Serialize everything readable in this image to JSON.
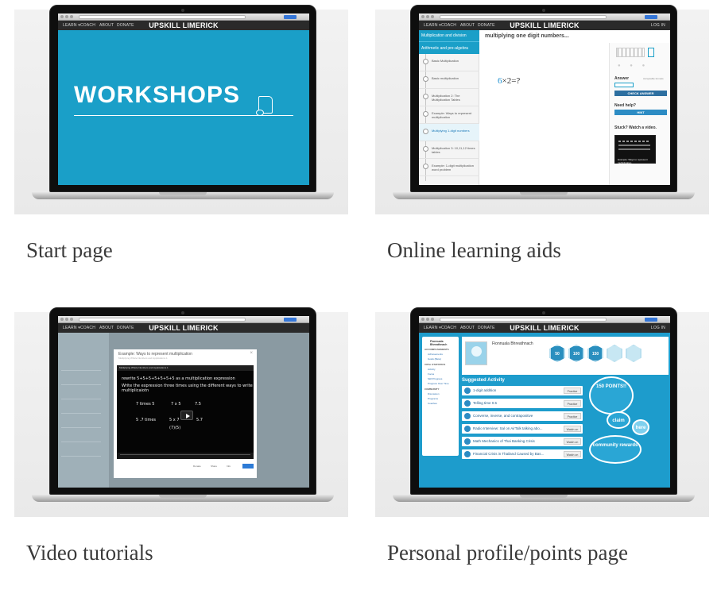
{
  "panels": [
    {
      "caption": "Start page",
      "site": {
        "brand": "UPSKILL LIMERICK",
        "nav": [
          "LEARN ▾",
          "COACH",
          "ABOUT",
          "DONATE"
        ],
        "login": "LOG IN"
      },
      "hero_title": "WORKSHOPS"
    },
    {
      "caption": "Online learning aids",
      "site": {
        "brand": "UPSKILL LIMERICK",
        "nav": [
          "LEARN ▾",
          "COACH",
          "ABOUT",
          "DONATE"
        ],
        "login": "LOG IN"
      },
      "sidebar": {
        "heading": "Multiplication and division",
        "subheading": "Arithmetic and pre-algebra",
        "items": [
          "Basic Multiplication",
          "Basic multiplication",
          "Multiplication 2: The Multiplication Tables",
          "Example: Ways to represent multiplication",
          "Multiplying 1-digit numbers",
          "Multiplication 3: 10,11,12 times tables",
          "Example: 1-digit multiplication word problem"
        ]
      },
      "exercise": {
        "title": "multiplying one digit numbers...",
        "problem_a": "6",
        "problem_rest": "×2=?",
        "answer_label": "Answer",
        "answer_note": "Acceptable formats",
        "check_button": "CHECK ANSWER",
        "need_help": "Need help?",
        "hint_button": "HINT",
        "stuck": "Stuck? Watch a video.",
        "video_caption": "Example: Ways to represent multiplication"
      }
    },
    {
      "caption": "Video tutorials",
      "site": {
        "brand": "UPSKILL LIMERICK",
        "nav": [
          "LEARN ▾",
          "COACH",
          "ABOUT",
          "DONATE"
        ],
        "login": "LOG IN"
      },
      "modal": {
        "title": "Example: Ways to represent multiplication",
        "subtitle": "Multiplying Whole Numbers and Applications 1",
        "video_header": "Multiplying Whole Numbers and Applications 1",
        "line1": "rewrite 5+5+5+5+5+5+5 as a multiplication expression",
        "line2": "Write the expression three times using the different ways to write multiplicaiotn",
        "cells": [
          "7 times 5",
          "7 x 5",
          "7.5",
          "5 .7 times",
          "5 x 7",
          "5.7",
          "(7)(5)"
        ],
        "foot": [
          "Donate",
          "Share",
          "Info"
        ]
      }
    },
    {
      "caption": "Personal profile/points page",
      "site": {
        "brand": "UPSKILL LIMERICK",
        "nav": [
          "LEARN ▾",
          "COACH",
          "ABOUT",
          "DONATE"
        ],
        "login": "LOG IN"
      },
      "profile": {
        "side_name": "Fionnuala Bhreathnach",
        "side_sections": [
          "ACCOMPLISHMENTS",
          "Achievements",
          "Goals (Beta)",
          "VITAL STATISTICS",
          "Activity",
          "Focus",
          "Skill Progress",
          "Progress Over Time",
          "COMMUNITY",
          "Discussion",
          "Programs",
          "Coaches"
        ],
        "name": "Fionnuala Bhreathnach",
        "badges": [
          "50",
          "100",
          "150",
          "",
          ""
        ],
        "suggested_title": "Suggested Activity",
        "activities": [
          {
            "title": "1-digit addition",
            "action": "Practice"
          },
          {
            "title": "Telling time 0.5",
            "action": "Practice"
          },
          {
            "title": "Converse, inverse, and contrapositive",
            "action": "Practice"
          },
          {
            "title": "Radio Interview: Sal on AirTalk talking abo...",
            "action": "Watch on"
          },
          {
            "title": "Math Mechanics of Thai Banking Crisis",
            "action": "Watch on"
          },
          {
            "title": "Financial Crisis in Thailand Caused by Bas...",
            "action": "Watch on"
          }
        ],
        "points": "150 POINTS!!",
        "claim": "claim",
        "here": "here",
        "community": "community rewards"
      }
    }
  ]
}
